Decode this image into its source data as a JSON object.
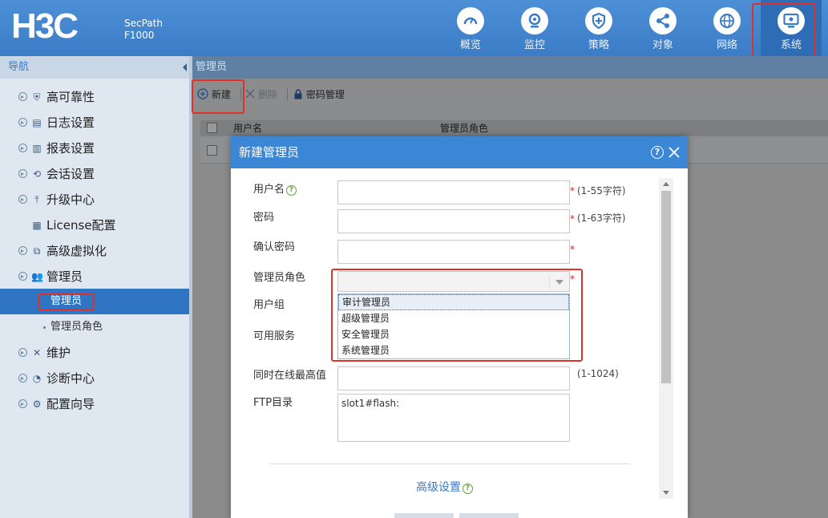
{
  "header": {
    "logo": "H3C",
    "product_line1": "SecPath",
    "product_line2": "F1000",
    "modules": [
      {
        "label": "概览",
        "icon": "gauge-icon"
      },
      {
        "label": "监控",
        "icon": "webcam-icon"
      },
      {
        "label": "策略",
        "icon": "shield-plus-icon"
      },
      {
        "label": "对象",
        "icon": "share-nodes-icon"
      },
      {
        "label": "网络",
        "icon": "globe-icon"
      },
      {
        "label": "系统",
        "icon": "monitor-settings-icon"
      }
    ],
    "active_module": "系统"
  },
  "sidebar": {
    "title": "导航",
    "items": [
      {
        "label": "高可靠性",
        "icon": "shield-icon"
      },
      {
        "label": "日志设置",
        "icon": "log-icon"
      },
      {
        "label": "报表设置",
        "icon": "report-icon"
      },
      {
        "label": "会话设置",
        "icon": "session-icon"
      },
      {
        "label": "升级中心",
        "icon": "upload-icon"
      },
      {
        "label": "License配置",
        "icon": "license-icon"
      },
      {
        "label": "高级虚拟化",
        "icon": "virtualization-icon"
      },
      {
        "label": "管理员",
        "icon": "users-icon"
      },
      {
        "label": "维护",
        "icon": "tools-icon"
      },
      {
        "label": "诊断中心",
        "icon": "diagnose-icon"
      },
      {
        "label": "配置向导",
        "icon": "wizard-icon"
      }
    ],
    "subitems": [
      {
        "label": "管理员",
        "active": true
      },
      {
        "label": "管理员角色",
        "active": false
      }
    ]
  },
  "main": {
    "breadcrumb": "管理员",
    "toolbar": {
      "new_label": "新建",
      "delete_label": "删除",
      "password_label": "密码管理"
    },
    "table": {
      "columns": [
        "用户名",
        "管理员角色"
      ]
    }
  },
  "dialog": {
    "title": "新建管理员",
    "fields": {
      "username": {
        "label": "用户名",
        "hint": "(1-55字符)",
        "value": ""
      },
      "password": {
        "label": "密码",
        "hint": "(1-63字符)",
        "value": ""
      },
      "confirm_password": {
        "label": "确认密码",
        "value": ""
      },
      "role": {
        "label": "管理员角色",
        "value": ""
      },
      "user_group": {
        "label": "用户组"
      },
      "services": {
        "label": "可用服务"
      },
      "max_online": {
        "label": "同时在线最高值",
        "hint": "(1-1024)",
        "value": ""
      },
      "ftp_dir": {
        "label": "FTP目录",
        "value": "slot1#flash:"
      }
    },
    "required_mark": "*",
    "role_options": [
      "审计管理员",
      "超级管理员",
      "安全管理员",
      "系统管理员"
    ],
    "highlighted_option": "审计管理员",
    "advanced_label": "高级设置"
  },
  "colors": {
    "header_blue": "#3b7cc7",
    "accent": "#2f75c4",
    "annotation_red": "#e0302a",
    "required_red": "#e02020",
    "help_green": "#5aa62d"
  }
}
